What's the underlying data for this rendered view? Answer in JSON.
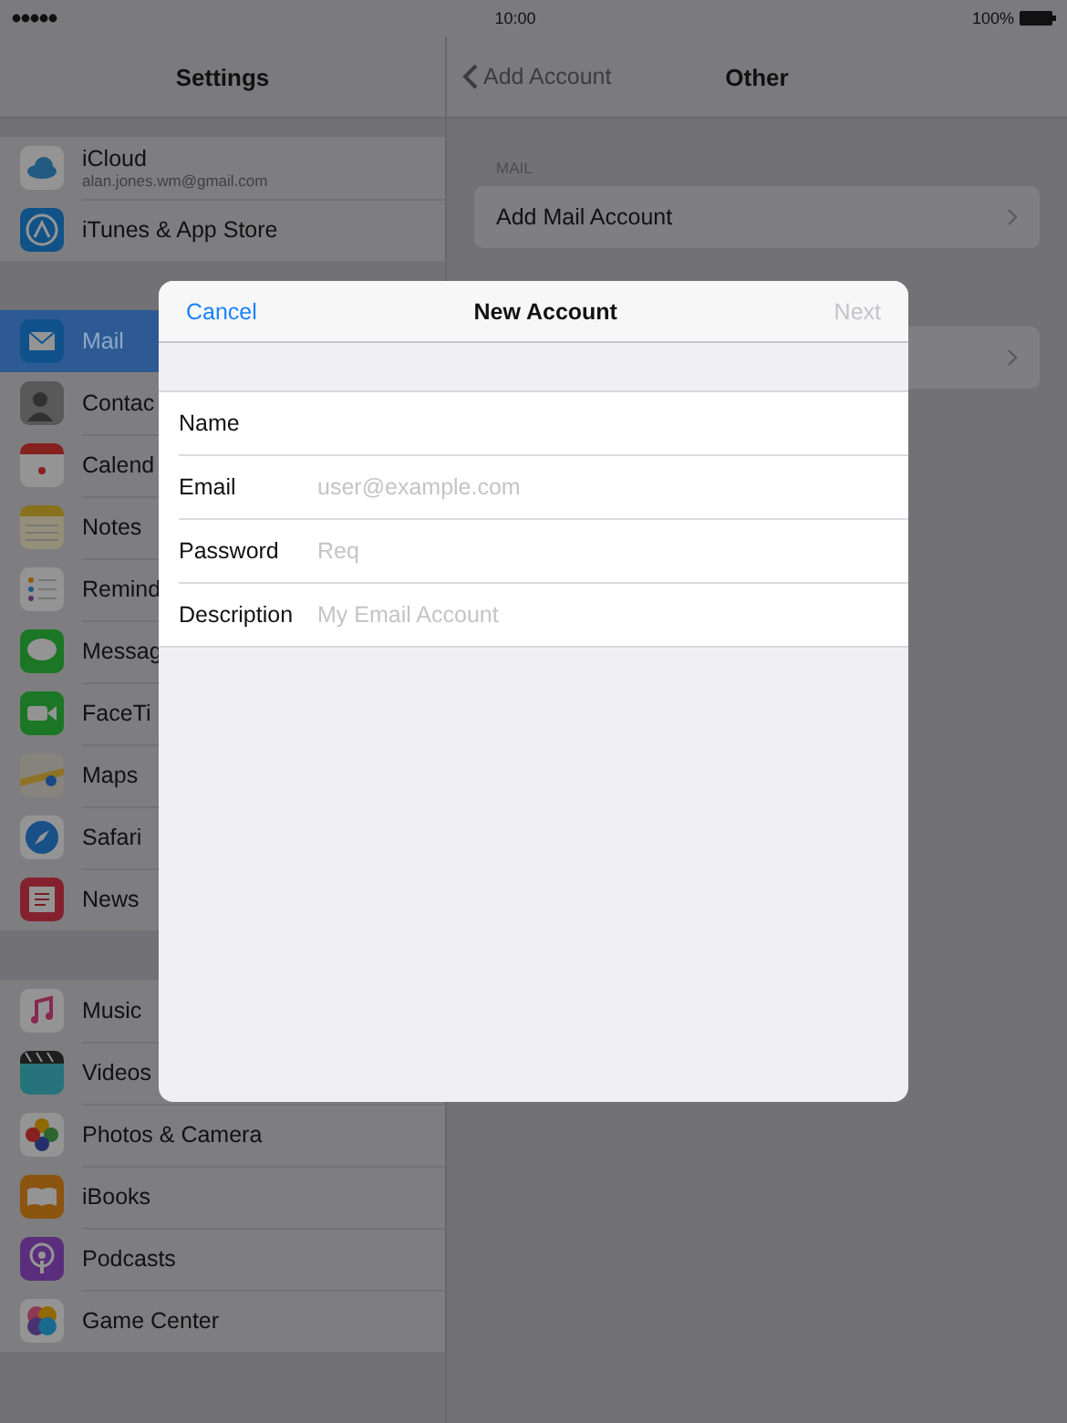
{
  "status_bar": {
    "time": "10:00",
    "battery": "100%"
  },
  "sidebar": {
    "title": "Settings",
    "groups": [
      {
        "items": [
          {
            "label": "iCloud",
            "subtitle": "alan.jones.wm@gmail.com",
            "kind": "cloud",
            "selected": false
          },
          {
            "label": "iTunes & App Store",
            "kind": "appstore",
            "selected": false
          }
        ]
      },
      {
        "items": [
          {
            "label": "Mail",
            "kind": "mail",
            "selected": true
          },
          {
            "label": "Contac",
            "kind": "contacts",
            "selected": false
          },
          {
            "label": "Calend",
            "kind": "calendar",
            "selected": false
          },
          {
            "label": "Notes",
            "kind": "notes",
            "selected": false
          },
          {
            "label": "Remind",
            "kind": "reminders",
            "selected": false
          },
          {
            "label": "Messag",
            "kind": "messages",
            "selected": false
          },
          {
            "label": "FaceTi",
            "kind": "facetime",
            "selected": false
          },
          {
            "label": "Maps",
            "kind": "maps",
            "selected": false
          },
          {
            "label": "Safari",
            "kind": "safari",
            "selected": false
          },
          {
            "label": "News",
            "kind": "news",
            "selected": false
          }
        ]
      },
      {
        "items": [
          {
            "label": "Music",
            "kind": "music",
            "selected": false
          },
          {
            "label": "Videos",
            "kind": "videos",
            "selected": false
          },
          {
            "label": "Photos & Camera",
            "kind": "photos",
            "selected": false
          },
          {
            "label": "iBooks",
            "kind": "ibooks",
            "selected": false
          },
          {
            "label": "Podcasts",
            "kind": "podcasts",
            "selected": false
          },
          {
            "label": "Game Center",
            "kind": "gamecenter",
            "selected": false
          }
        ]
      }
    ]
  },
  "detail": {
    "back": "Add Account",
    "title": "Other",
    "sections": [
      {
        "header": "MAIL",
        "rows": [
          {
            "kind": "link",
            "label": "Add Mail Account"
          }
        ]
      },
      {
        "rows": [
          {
            "kind": "chevron_only"
          }
        ]
      }
    ]
  },
  "modal": {
    "cancel": "Cancel",
    "title": "New Account",
    "next": {
      "label": "Next",
      "disabled": true
    },
    "fields": [
      {
        "label": "Name"
      },
      {
        "label": "Email",
        "placeholder": "user@example.com"
      },
      {
        "label": "Password",
        "placeholder": "Req"
      },
      {
        "label": "Description",
        "placeholder": "My Email Account"
      }
    ]
  }
}
